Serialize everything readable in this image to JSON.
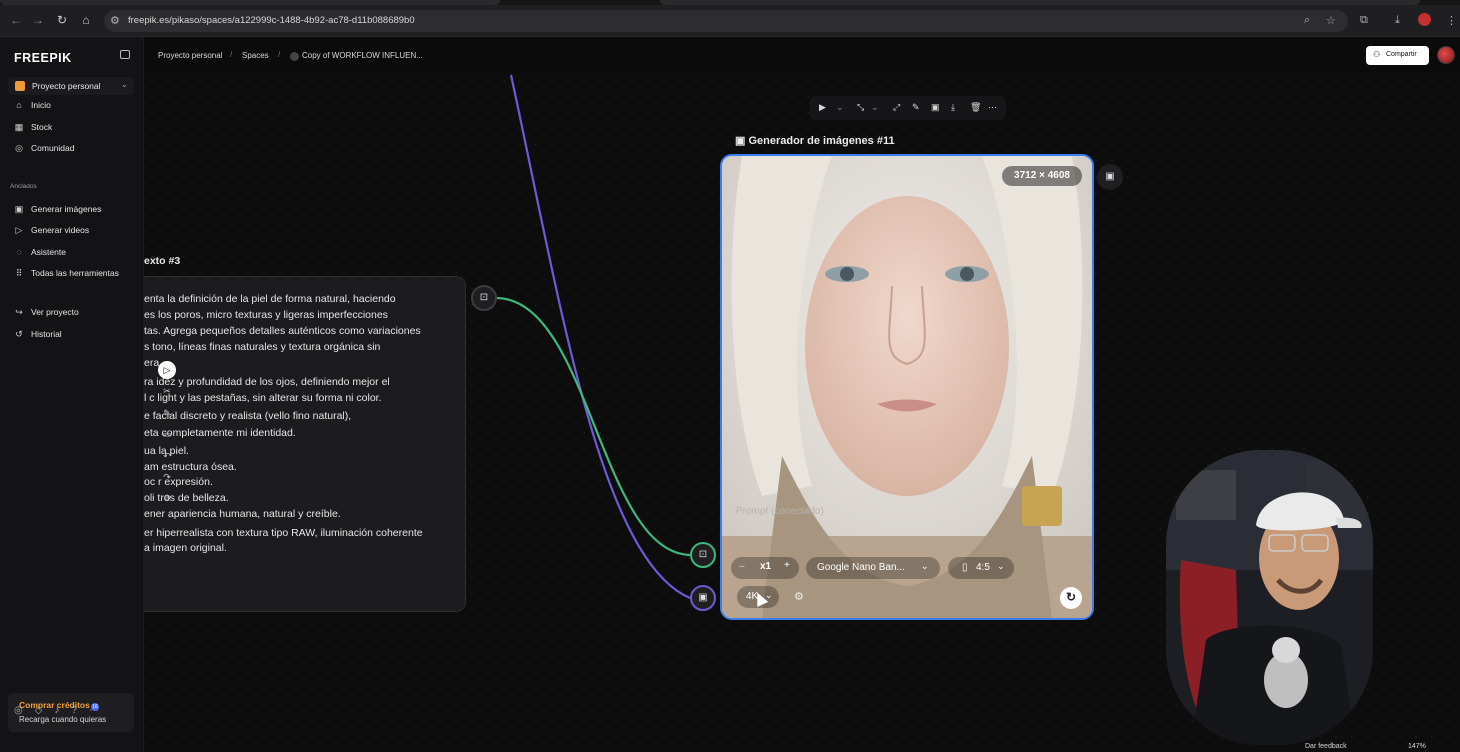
{
  "browser": {
    "url": "freepik.es/pikaso/spaces/a122999c-1488-4b92-ac78-d11b088689b0"
  },
  "sidebar": {
    "logo": "FREEPIK",
    "project": "Proyecto personal",
    "nav": [
      {
        "label": "Inicio",
        "icon": "home-icon"
      },
      {
        "label": "Stock",
        "icon": "stock-icon"
      },
      {
        "label": "Comunidad",
        "icon": "globe-icon"
      }
    ],
    "pinned_title": "Anclados",
    "pinned": [
      {
        "label": "Generar imágenes",
        "icon": "image-icon"
      },
      {
        "label": "Generar videos",
        "icon": "video-icon"
      },
      {
        "label": "Asistente",
        "icon": "assistant-icon"
      },
      {
        "label": "Todas las herramientas",
        "icon": "grid-icon"
      }
    ],
    "extra": [
      {
        "label": "Ver proyecto",
        "icon": "exit-icon"
      },
      {
        "label": "Historial",
        "icon": "history-icon"
      }
    ],
    "credits_title": "Comprar créditos",
    "credits_sub": "Recarga cuando quieras",
    "notification_count": "16"
  },
  "breadcrumb": {
    "project": "Proyecto personal",
    "spaces": "Spaces",
    "current": "Copy of WORKFLOW INFLUEN..."
  },
  "share_label": "Compartir",
  "text_node": {
    "title": "exto #3",
    "lines": [
      "enta la definición de la piel de forma natural, haciendo",
      "es los poros, micro texturas y ligeras imperfecciones",
      "tas. Agrega pequeños detalles auténticos como variaciones",
      "s      tono, líneas finas naturales y textura orgánica sin",
      "era",
      "ra      idez y profundidad de los ojos, definiendo mejor el",
      "l c     light y las pestañas, sin alterar su forma ni color.",
      "e        facial discreto y realista (vello fino natural),",
      "eta      completamente mi identidad.",
      "ua       la piel.",
      "am       estructura ósea.",
      "oc       r expresión.",
      "oli      tros de belleza.",
      "ener apariencia humana, natural y creíble.",
      "er hiperrealista con textura tipo RAW, iluminación coherente",
      "a imagen original."
    ]
  },
  "image_node": {
    "title": "Generador de imágenes #11",
    "dimensions": "3712 × 4608",
    "prompt_placeholder": "Prompt (conectado)",
    "count": "x1",
    "model": "Google Nano Ban...",
    "aspect": "4:5",
    "resolution": "4K"
  },
  "footer": {
    "feedback": "Dar feedback",
    "zoom": "147%"
  },
  "colors": {
    "accent_blue": "#3b7df2",
    "edge_green": "#3cb97a",
    "edge_purple": "#6b5bd6",
    "credits_orange": "#f6a13a"
  }
}
